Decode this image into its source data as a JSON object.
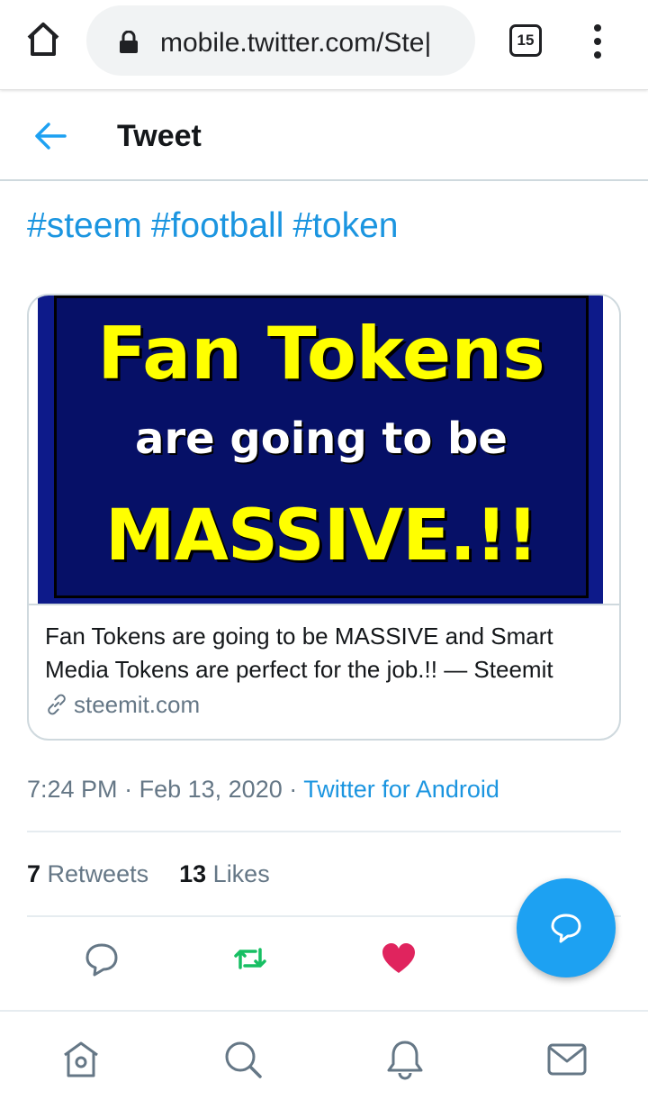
{
  "browser": {
    "url": "mobile.twitter.com/Ste|",
    "tab_count": "15"
  },
  "header": {
    "title": "Tweet"
  },
  "tweet": {
    "hashtags": [
      "#steem",
      "#football",
      "#token"
    ],
    "card": {
      "image_text": {
        "line1": "Fan Tokens",
        "line2": "are going to be",
        "line3": "MASSIVE.!!"
      },
      "title": "Fan Tokens are going to be MASSIVE and Smart Media Tokens are perfect for the job.!! — Steemit",
      "domain": "steemit.com"
    },
    "time": "7:24 PM",
    "date": "Feb 13, 2020",
    "separator": "·",
    "source": "Twitter for Android",
    "retweets_count": "7",
    "retweets_label": "Retweets",
    "likes_count": "13",
    "likes_label": "Likes"
  },
  "colors": {
    "accent": "#1da1f2",
    "link": "#1b95e0",
    "retweet": "#17bf63",
    "like": "#e0245e",
    "banner_bg": "#061067",
    "banner_yellow": "#ffff00"
  },
  "icons": {
    "chrome": [
      "home-icon",
      "lock-icon",
      "menu-dots-icon"
    ],
    "header": [
      "back-arrow-icon"
    ],
    "card": [
      "link-icon"
    ],
    "actions": [
      "reply-icon",
      "retweet-icon",
      "like-heart-icon"
    ],
    "fab": "compose-icon",
    "bottom_nav": [
      "home-icon",
      "search-icon",
      "notifications-bell-icon",
      "messages-mail-icon"
    ]
  }
}
